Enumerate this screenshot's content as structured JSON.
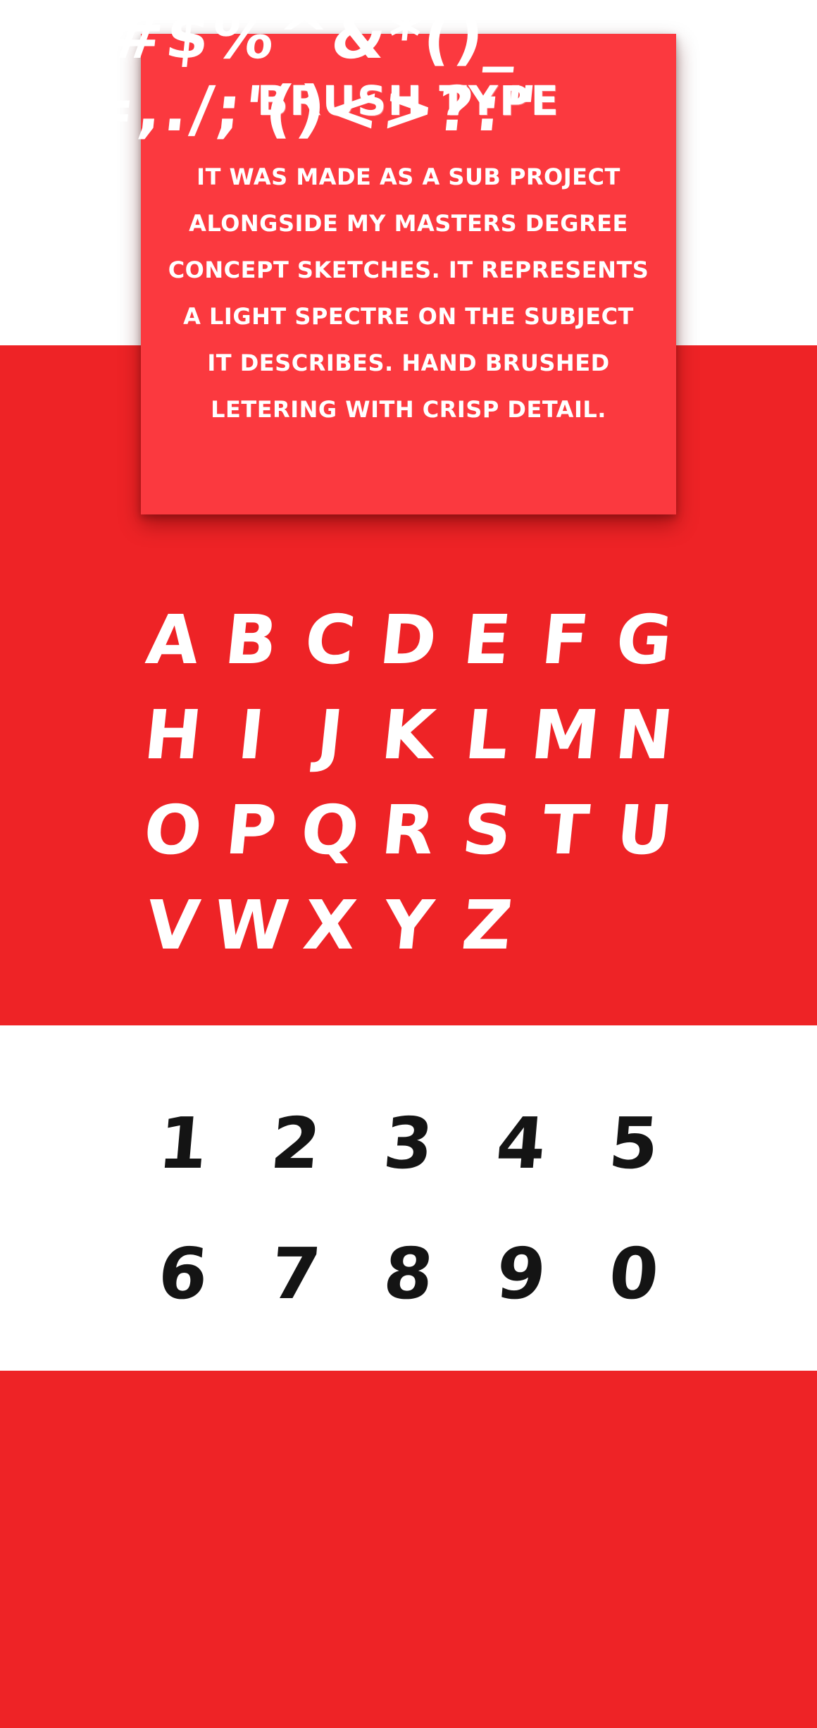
{
  "intro": {
    "title": "BRUSH TYPE",
    "lines": [
      "IT WAS MADE AS A SUB PROJECT",
      "ALONGSIDE MY MASTERS DEGREE",
      "CONCEPT SKETCHES. IT REPRESENTS",
      "A LIGHT SPECTRE ON THE SUBJECT",
      "IT DESCRIBES. HAND BRUSHED",
      "LETERING WITH CRISP DETAIL."
    ]
  },
  "letters": [
    "A",
    "B",
    "C",
    "D",
    "E",
    "F",
    "G",
    "H",
    "I",
    "J",
    "K",
    "L",
    "M",
    "N",
    "O",
    "P",
    "Q",
    "R",
    "S",
    "T",
    "U",
    "V",
    "W",
    "X",
    "Y",
    "Z"
  ],
  "digits": [
    "1",
    "2",
    "3",
    "4",
    "5",
    "6",
    "7",
    "8",
    "9",
    "0"
  ],
  "symbols": {
    "row1": "!@#$%^&*()_",
    "row2": "+-=,./;'()<>?:\""
  },
  "colors": {
    "red_band": "#ee2326",
    "card_red": "#fb393f",
    "white": "#ffffff",
    "digit_ink": "#141414"
  }
}
